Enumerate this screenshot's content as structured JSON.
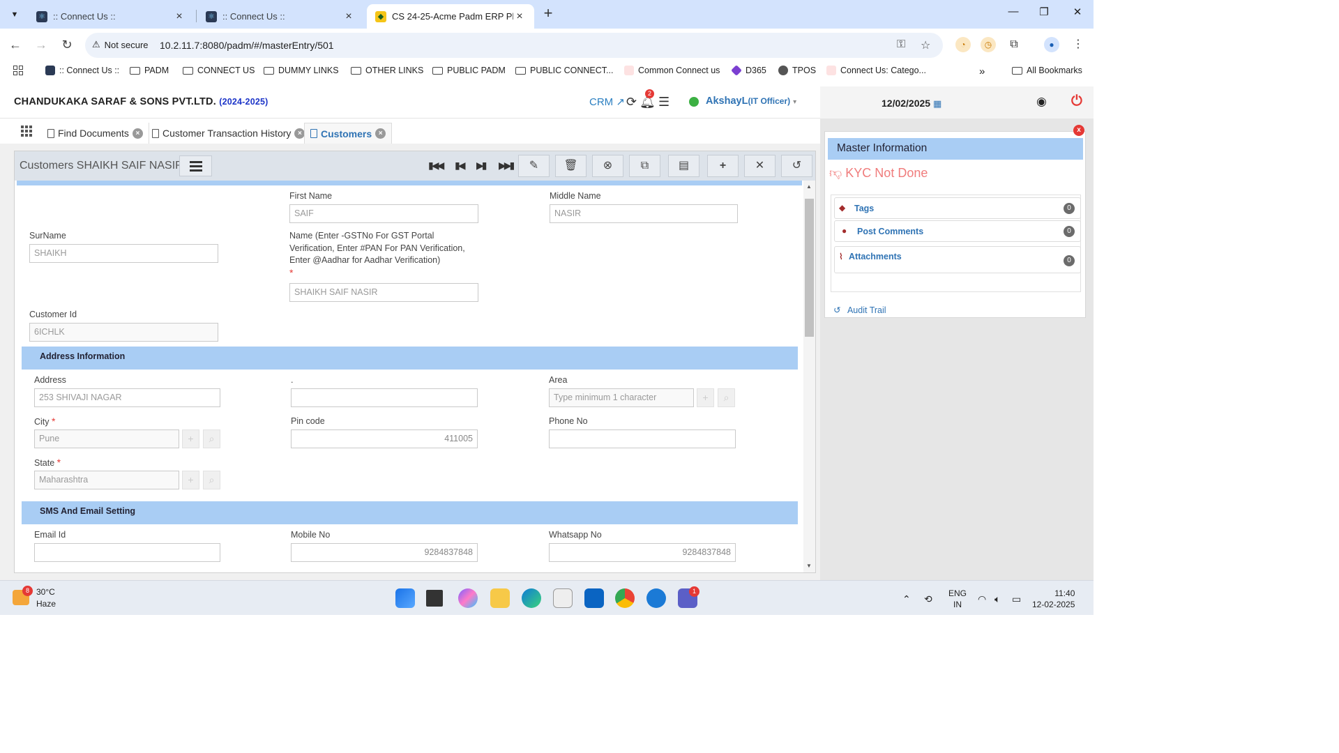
{
  "browser": {
    "tabs": [
      {
        "title": ":: Connect Us ::",
        "active": false
      },
      {
        "title": ":: Connect Us ::",
        "active": false
      },
      {
        "title": "CS 24-25-Acme Padm ERP Platf",
        "active": true
      }
    ],
    "security_label": "Not secure",
    "url": "10.2.11.7:8080/padm/#/masterEntry/501",
    "bookmarks": [
      {
        "label": ":: Connect Us ::",
        "type": "site"
      },
      {
        "label": "PADM",
        "type": "folder"
      },
      {
        "label": "CONNECT US",
        "type": "folder"
      },
      {
        "label": "DUMMY LINKS",
        "type": "folder"
      },
      {
        "label": "OTHER LINKS",
        "type": "folder"
      },
      {
        "label": "PUBLIC PADM",
        "type": "folder"
      },
      {
        "label": "PUBLIC CONNECT...",
        "type": "folder"
      },
      {
        "label": "Common Connect us",
        "type": "site"
      },
      {
        "label": "D365",
        "type": "site"
      },
      {
        "label": "TPOS",
        "type": "site"
      },
      {
        "label": "Connect Us: Catego...",
        "type": "site"
      }
    ],
    "all_bookmarks": "All Bookmarks"
  },
  "header": {
    "company": "CHANDUKAKA SARAF & SONS PVT.LTD.",
    "year": "(2024-2025)",
    "crm_label": "CRM",
    "notification_count": "2",
    "user_name": "AkshayL",
    "user_role": "(IT Officer)",
    "date": "12/02/2025"
  },
  "module_tabs": [
    {
      "label": "Find Documents",
      "active": false
    },
    {
      "label": "Customer Transaction History",
      "active": false
    },
    {
      "label": "Customers",
      "active": true
    }
  ],
  "form": {
    "title": "Customers SHAIKH SAIF NASIR",
    "fields": {
      "first_name": {
        "label": "First Name",
        "value": "SAIF"
      },
      "middle_name": {
        "label": "Middle Name",
        "value": "NASIR"
      },
      "surname": {
        "label": "SurName",
        "value": "SHAIKH"
      },
      "name": {
        "label_1": "Name (Enter -GSTNo For GST Portal",
        "label_2": "Verification, Enter #PAN For PAN Verification,",
        "label_3": "Enter @Aadhar for Aadhar Verification)",
        "value": "SHAIKH SAIF NASIR"
      },
      "customer_id": {
        "label": "Customer Id",
        "value": "6ICHLK"
      }
    },
    "address_section": {
      "title": "Address Information",
      "address": {
        "label": "Address",
        "value": "253 SHIVAJI NAGAR"
      },
      "address2": {
        "label": ".",
        "value": ""
      },
      "area": {
        "label": "Area",
        "placeholder": "Type minimum 1 character"
      },
      "city": {
        "label": "City",
        "value": "Pune"
      },
      "pin": {
        "label": "Pin code",
        "value": "411005"
      },
      "phone": {
        "label": "Phone No",
        "value": ""
      },
      "state": {
        "label": "State",
        "value": "Maharashtra"
      }
    },
    "sms_section": {
      "title": "SMS And Email Setting",
      "email": {
        "label": "Email Id",
        "value": ""
      },
      "mobile": {
        "label": "Mobile No",
        "value": "9284837848"
      },
      "whatsapp": {
        "label": "Whatsapp No",
        "value": "9284837848"
      }
    }
  },
  "master_info": {
    "title": "Master Information",
    "kyc_status": "KYC Not Done",
    "items": [
      {
        "label": "Tags",
        "count": "0"
      },
      {
        "label": "Post Comments",
        "count": "0"
      },
      {
        "label": "Attachments",
        "count": "0"
      }
    ],
    "audit_trail": "Audit Trail",
    "close_label": "x"
  },
  "taskbar": {
    "temperature": "30°C",
    "weather": "Haze",
    "weather_badge": "8",
    "teams_badge": "1",
    "lang_1": "ENG",
    "lang_2": "IN",
    "time": "11:40",
    "date": "12-02-2025"
  },
  "colors": {
    "section_bg": "#a9cdf4",
    "link_blue": "#2f73b4",
    "danger": "#e53935",
    "kyc": "#f07c7c"
  }
}
